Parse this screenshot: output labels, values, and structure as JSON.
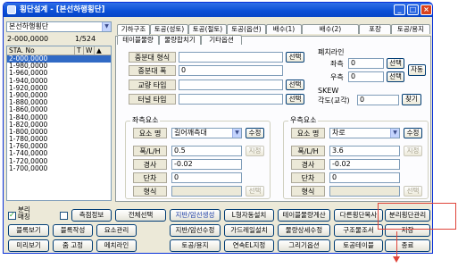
{
  "window": {
    "title": "횡단설계 - [본선하행횡단]"
  },
  "left": {
    "combo": "본선하행횡단",
    "station_range": "2-000,0000",
    "position": "1/524",
    "list_headers": [
      "STA. No",
      "T",
      "W",
      "▲"
    ],
    "stations": [
      "2-000,0000",
      "1-980,0000",
      "1-960,0000",
      "1-940,0000",
      "1-920,0000",
      "1-900,0000",
      "1-880,0000",
      "1-860,0000",
      "1-840,0000",
      "1-820,0000",
      "1-800,0000",
      "1-780,0000",
      "1-760,0000",
      "1-740,0000",
      "1-720,0000",
      "1-700,0000"
    ]
  },
  "tabs_row1": [
    "기하구조",
    "토공(성토)",
    "토공(절토)",
    "토공(옵션)",
    "배수(1)",
    "배수(2)",
    "포장",
    "토공/용지"
  ],
  "tabs_row2": [
    "테이블물량",
    "물량합치기",
    "기타옵션"
  ],
  "geometry": {
    "labels": [
      "중분대 형식",
      "중분대 폭",
      "교량 타입",
      "터널 타입"
    ],
    "width_value": "0",
    "select_label": "선택"
  },
  "slab": {
    "title": "폐치라인",
    "left_label": "좌측",
    "left_value": "0",
    "right_label": "우측",
    "right_value": "0",
    "select_label": "선택",
    "auto_label": "자동"
  },
  "skew": {
    "title": "SKEW",
    "angle_label": "각도(교각)",
    "angle_value": "0",
    "find_label": "찾기"
  },
  "left_elem": {
    "title": "좌측요소",
    "name_label": "요소 명",
    "name_value": "길어깨측대",
    "edit_label": "수정",
    "width_label": "폭/L/H",
    "width_value": "0.5",
    "designate_label": "지정",
    "slope_label": "경사",
    "slope_value": "-0.02",
    "step_label": "단차",
    "step_value": "0",
    "type_label": "형식",
    "select_label": "선택"
  },
  "right_elem": {
    "title": "우측요소",
    "name_label": "요소 명",
    "name_value": "차로",
    "edit_label": "수정",
    "width_label": "폭/L/H",
    "width_value": "3.6",
    "designate_label": "지정",
    "slope_label": "경사",
    "slope_value": "-0.02",
    "step_label": "단차",
    "step_value": "0",
    "type_label": "형식",
    "select_label": "선택"
  },
  "bottom": {
    "sep_label": "분리 매칭",
    "row1": [
      "측점정보",
      "전체선택",
      "지반/암선생성",
      "L형자동설치",
      "테이블물량계산",
      "다른횡단복사",
      "분리횡단관리"
    ],
    "row2": [
      "블록보기",
      "블록작성",
      "요소관리",
      "지반/암선수정",
      "가드레일설치",
      "물량상세수정",
      "구조물조서",
      "저장"
    ],
    "row3": [
      "미리보기",
      "줌 고정",
      "메치라인",
      "토공/용지",
      "연속EL지정",
      "그리기옵션",
      "토공테이블",
      "종료"
    ]
  },
  "annotation_color": "#e0443a"
}
